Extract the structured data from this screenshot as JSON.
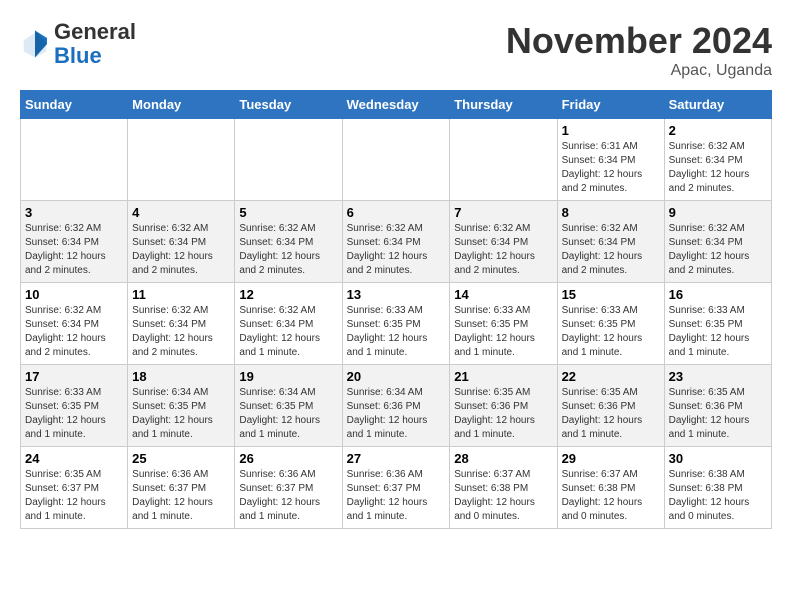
{
  "logo": {
    "general": "General",
    "blue": "Blue"
  },
  "header": {
    "month": "November 2024",
    "location": "Apac, Uganda"
  },
  "weekdays": [
    "Sunday",
    "Monday",
    "Tuesday",
    "Wednesday",
    "Thursday",
    "Friday",
    "Saturday"
  ],
  "weeks": [
    [
      {
        "day": "",
        "info": ""
      },
      {
        "day": "",
        "info": ""
      },
      {
        "day": "",
        "info": ""
      },
      {
        "day": "",
        "info": ""
      },
      {
        "day": "",
        "info": ""
      },
      {
        "day": "1",
        "info": "Sunrise: 6:31 AM\nSunset: 6:34 PM\nDaylight: 12 hours and 2 minutes."
      },
      {
        "day": "2",
        "info": "Sunrise: 6:32 AM\nSunset: 6:34 PM\nDaylight: 12 hours and 2 minutes."
      }
    ],
    [
      {
        "day": "3",
        "info": "Sunrise: 6:32 AM\nSunset: 6:34 PM\nDaylight: 12 hours and 2 minutes."
      },
      {
        "day": "4",
        "info": "Sunrise: 6:32 AM\nSunset: 6:34 PM\nDaylight: 12 hours and 2 minutes."
      },
      {
        "day": "5",
        "info": "Sunrise: 6:32 AM\nSunset: 6:34 PM\nDaylight: 12 hours and 2 minutes."
      },
      {
        "day": "6",
        "info": "Sunrise: 6:32 AM\nSunset: 6:34 PM\nDaylight: 12 hours and 2 minutes."
      },
      {
        "day": "7",
        "info": "Sunrise: 6:32 AM\nSunset: 6:34 PM\nDaylight: 12 hours and 2 minutes."
      },
      {
        "day": "8",
        "info": "Sunrise: 6:32 AM\nSunset: 6:34 PM\nDaylight: 12 hours and 2 minutes."
      },
      {
        "day": "9",
        "info": "Sunrise: 6:32 AM\nSunset: 6:34 PM\nDaylight: 12 hours and 2 minutes."
      }
    ],
    [
      {
        "day": "10",
        "info": "Sunrise: 6:32 AM\nSunset: 6:34 PM\nDaylight: 12 hours and 2 minutes."
      },
      {
        "day": "11",
        "info": "Sunrise: 6:32 AM\nSunset: 6:34 PM\nDaylight: 12 hours and 2 minutes."
      },
      {
        "day": "12",
        "info": "Sunrise: 6:32 AM\nSunset: 6:34 PM\nDaylight: 12 hours and 1 minute."
      },
      {
        "day": "13",
        "info": "Sunrise: 6:33 AM\nSunset: 6:35 PM\nDaylight: 12 hours and 1 minute."
      },
      {
        "day": "14",
        "info": "Sunrise: 6:33 AM\nSunset: 6:35 PM\nDaylight: 12 hours and 1 minute."
      },
      {
        "day": "15",
        "info": "Sunrise: 6:33 AM\nSunset: 6:35 PM\nDaylight: 12 hours and 1 minute."
      },
      {
        "day": "16",
        "info": "Sunrise: 6:33 AM\nSunset: 6:35 PM\nDaylight: 12 hours and 1 minute."
      }
    ],
    [
      {
        "day": "17",
        "info": "Sunrise: 6:33 AM\nSunset: 6:35 PM\nDaylight: 12 hours and 1 minute."
      },
      {
        "day": "18",
        "info": "Sunrise: 6:34 AM\nSunset: 6:35 PM\nDaylight: 12 hours and 1 minute."
      },
      {
        "day": "19",
        "info": "Sunrise: 6:34 AM\nSunset: 6:35 PM\nDaylight: 12 hours and 1 minute."
      },
      {
        "day": "20",
        "info": "Sunrise: 6:34 AM\nSunset: 6:36 PM\nDaylight: 12 hours and 1 minute."
      },
      {
        "day": "21",
        "info": "Sunrise: 6:35 AM\nSunset: 6:36 PM\nDaylight: 12 hours and 1 minute."
      },
      {
        "day": "22",
        "info": "Sunrise: 6:35 AM\nSunset: 6:36 PM\nDaylight: 12 hours and 1 minute."
      },
      {
        "day": "23",
        "info": "Sunrise: 6:35 AM\nSunset: 6:36 PM\nDaylight: 12 hours and 1 minute."
      }
    ],
    [
      {
        "day": "24",
        "info": "Sunrise: 6:35 AM\nSunset: 6:37 PM\nDaylight: 12 hours and 1 minute."
      },
      {
        "day": "25",
        "info": "Sunrise: 6:36 AM\nSunset: 6:37 PM\nDaylight: 12 hours and 1 minute."
      },
      {
        "day": "26",
        "info": "Sunrise: 6:36 AM\nSunset: 6:37 PM\nDaylight: 12 hours and 1 minute."
      },
      {
        "day": "27",
        "info": "Sunrise: 6:36 AM\nSunset: 6:37 PM\nDaylight: 12 hours and 1 minute."
      },
      {
        "day": "28",
        "info": "Sunrise: 6:37 AM\nSunset: 6:38 PM\nDaylight: 12 hours and 0 minutes."
      },
      {
        "day": "29",
        "info": "Sunrise: 6:37 AM\nSunset: 6:38 PM\nDaylight: 12 hours and 0 minutes."
      },
      {
        "day": "30",
        "info": "Sunrise: 6:38 AM\nSunset: 6:38 PM\nDaylight: 12 hours and 0 minutes."
      }
    ]
  ]
}
